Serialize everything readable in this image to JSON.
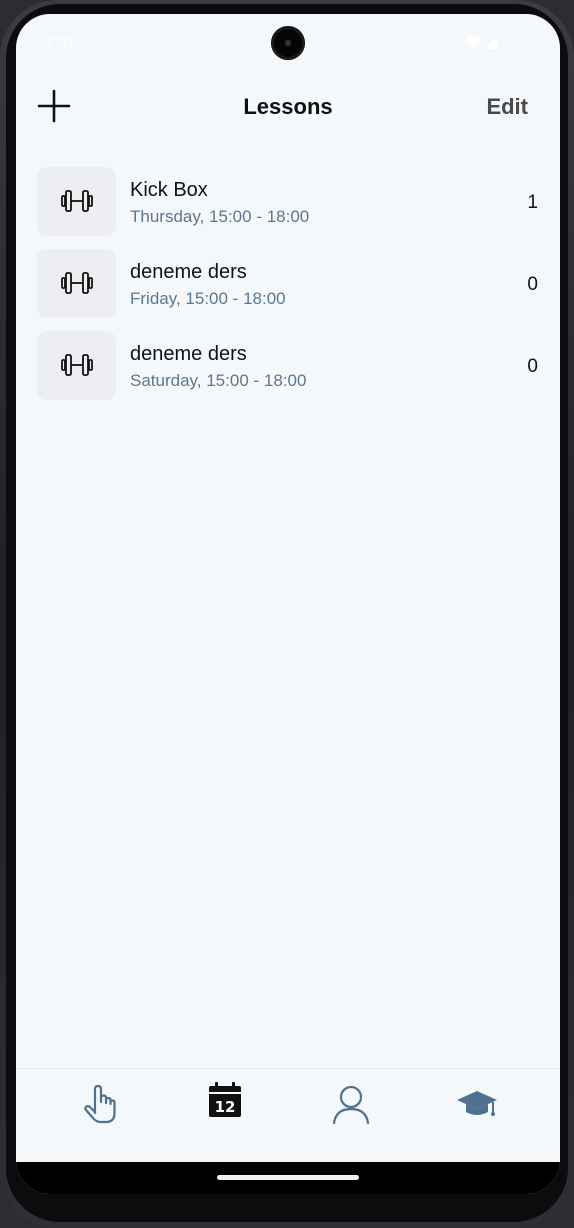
{
  "status_bar": {
    "time": "1:51",
    "icons": [
      "wifi-icon",
      "signal-icon"
    ]
  },
  "header": {
    "title": "Lessons",
    "edit_label": "Edit",
    "add_icon": "plus-icon"
  },
  "lessons": [
    {
      "name": "Kick Box",
      "schedule": "Thursday, 15:00 - 18:00",
      "count": "1",
      "icon": "dumbbell-icon"
    },
    {
      "name": "deneme ders",
      "schedule": "Friday, 15:00 - 18:00",
      "count": "0",
      "icon": "dumbbell-icon"
    },
    {
      "name": "deneme ders",
      "schedule": "Saturday, 15:00 - 18:00",
      "count": "0",
      "icon": "dumbbell-icon"
    }
  ],
  "bottom_nav": {
    "items": [
      {
        "icon": "hand-pointer-icon",
        "active": false
      },
      {
        "icon": "calendar-icon",
        "label": "12",
        "active": true
      },
      {
        "icon": "user-icon",
        "active": false
      },
      {
        "icon": "graduation-cap-icon",
        "active": false
      }
    ]
  },
  "colors": {
    "background": "#f5f8fb",
    "subtitle": "#5b7890",
    "icon_box": "#eceef1",
    "nav_icon": "#4e7191",
    "nav_active": "#111111"
  }
}
